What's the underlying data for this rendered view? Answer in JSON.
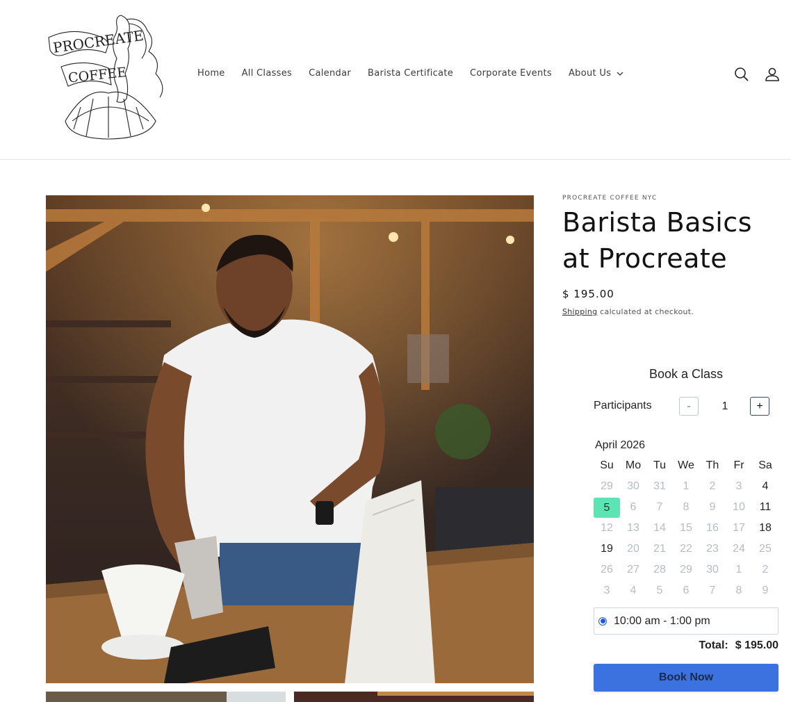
{
  "brand": {
    "logo_text": "PROCREATE COFFEE"
  },
  "nav": {
    "items": [
      "Home",
      "All Classes",
      "Calendar",
      "Barista Certificate",
      "Corporate Events",
      "About Us"
    ]
  },
  "header_icons": [
    "search-icon",
    "account-icon"
  ],
  "product": {
    "vendor": "PROCREATE COFFEE NYC",
    "title": "Barista Basics at Procreate",
    "price": "$ 195.00",
    "shipping_link": "Shipping",
    "shipping_rest": " calculated at checkout."
  },
  "booking": {
    "title": "Book a Class",
    "participants_label": "Participants",
    "minus": "-",
    "plus": "+",
    "quantity": "1",
    "month": "April 2026",
    "weekdays": [
      "Su",
      "Mo",
      "Tu",
      "We",
      "Th",
      "Fr",
      "Sa"
    ],
    "weeks": [
      [
        [
          "29",
          "dim"
        ],
        [
          "30",
          "dim"
        ],
        [
          "31",
          "dim"
        ],
        [
          "1",
          "dim"
        ],
        [
          "2",
          "dim"
        ],
        [
          "3",
          "dim"
        ],
        [
          "4",
          "on"
        ]
      ],
      [
        [
          "5",
          "sel"
        ],
        [
          "6",
          "dim"
        ],
        [
          "7",
          "dim"
        ],
        [
          "8",
          "dim"
        ],
        [
          "9",
          "dim"
        ],
        [
          "10",
          "dim"
        ],
        [
          "11",
          "on"
        ]
      ],
      [
        [
          "12",
          "dim"
        ],
        [
          "13",
          "dim"
        ],
        [
          "14",
          "dim"
        ],
        [
          "15",
          "dim"
        ],
        [
          "16",
          "dim"
        ],
        [
          "17",
          "dim"
        ],
        [
          "18",
          "on"
        ]
      ],
      [
        [
          "19",
          "on"
        ],
        [
          "20",
          "dim"
        ],
        [
          "21",
          "dim"
        ],
        [
          "22",
          "dim"
        ],
        [
          "23",
          "dim"
        ],
        [
          "24",
          "dim"
        ],
        [
          "25",
          "dim"
        ]
      ],
      [
        [
          "26",
          "dim"
        ],
        [
          "27",
          "dim"
        ],
        [
          "28",
          "dim"
        ],
        [
          "29",
          "dim"
        ],
        [
          "30",
          "dim"
        ],
        [
          "1",
          "dim"
        ],
        [
          "2",
          "dim"
        ]
      ],
      [
        [
          "3",
          "dim"
        ],
        [
          "4",
          "dim"
        ],
        [
          "5",
          "dim"
        ],
        [
          "6",
          "dim"
        ],
        [
          "7",
          "dim"
        ],
        [
          "8",
          "dim"
        ],
        [
          "9",
          "dim"
        ]
      ]
    ],
    "slot": "10:00 am - 1:00 pm",
    "total_label": "Total:",
    "total_value": "$ 195.00",
    "book_now": "Book Now"
  },
  "colors": {
    "selected_day": "#5ee3b4",
    "book_button": "#3b72e0",
    "radio": "#1f5bd6"
  }
}
